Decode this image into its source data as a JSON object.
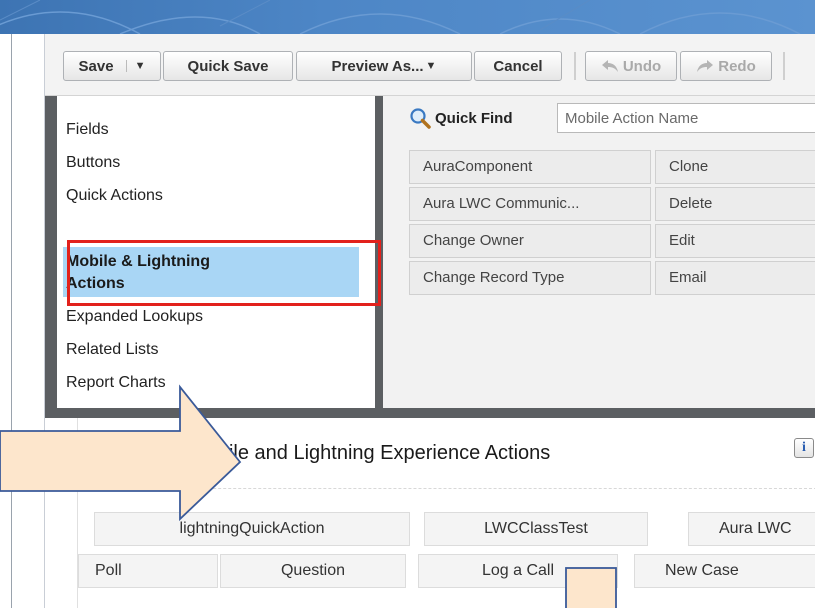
{
  "toolbar": {
    "save_label": "Save",
    "save_menu_caret": "▼",
    "quick_save_label": "Quick Save",
    "preview_as_label": "Preview As...",
    "preview_caret": "▼",
    "cancel_label": "Cancel",
    "undo_label": "Undo",
    "redo_label": "Redo"
  },
  "categories": {
    "items": [
      {
        "label": "Fields"
      },
      {
        "label": "Buttons"
      },
      {
        "label": "Quick Actions"
      },
      {
        "label_line1": "Mobile & Lightning",
        "label_line2": "Actions",
        "selected": true
      },
      {
        "label": "Expanded Lookups"
      },
      {
        "label": "Related Lists"
      },
      {
        "label": "Report Charts"
      }
    ]
  },
  "quick_find": {
    "label": "Quick Find",
    "placeholder": "Mobile Action Name"
  },
  "palette_elements": {
    "column1": [
      "AuraComponent",
      "Aura LWC Communic...",
      "Change Owner",
      "Change Record Type"
    ],
    "column2": [
      "Clone",
      "Delete",
      "Edit",
      "Email"
    ]
  },
  "layout_section": {
    "title": "Salesforce Mobile and Lightning Experience Actions",
    "info_icon_text": "i",
    "row1": [
      "lightningQuickAction",
      "LWCClassTest",
      "Aura LWC"
    ],
    "row2": [
      "Poll",
      "Question",
      "Log a Call",
      "New Case"
    ]
  },
  "colors": {
    "selected_bg": "#a9d6f5",
    "highlight_border": "#e2211c",
    "annotation_fill": "#fde6cc",
    "annotation_stroke": "#3a5a99"
  }
}
